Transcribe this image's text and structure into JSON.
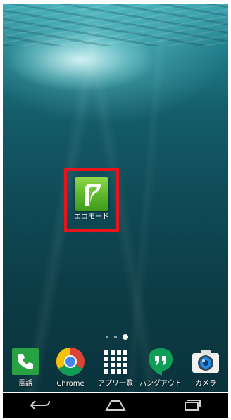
{
  "home_screen": {
    "highlighted_app": {
      "label": "エコモード",
      "icon": "eco-mode-battery-icon",
      "highlight_color": "#e8141c",
      "icon_color": "#5bb52a"
    },
    "page_indicator": {
      "pages": 3,
      "current_page": 3
    }
  },
  "dock": {
    "items": [
      {
        "label": "電話",
        "icon": "phone-icon"
      },
      {
        "label": "Chrome",
        "icon": "chrome-icon"
      },
      {
        "label": "アプリ一覧",
        "icon": "app-drawer-icon"
      },
      {
        "label": "ハングアウト",
        "icon": "hangouts-icon"
      },
      {
        "label": "カメラ",
        "icon": "camera-icon"
      }
    ]
  },
  "navigation_bar": {
    "buttons": [
      {
        "icon": "back-icon"
      },
      {
        "icon": "home-icon"
      },
      {
        "icon": "recent-apps-icon"
      }
    ]
  }
}
